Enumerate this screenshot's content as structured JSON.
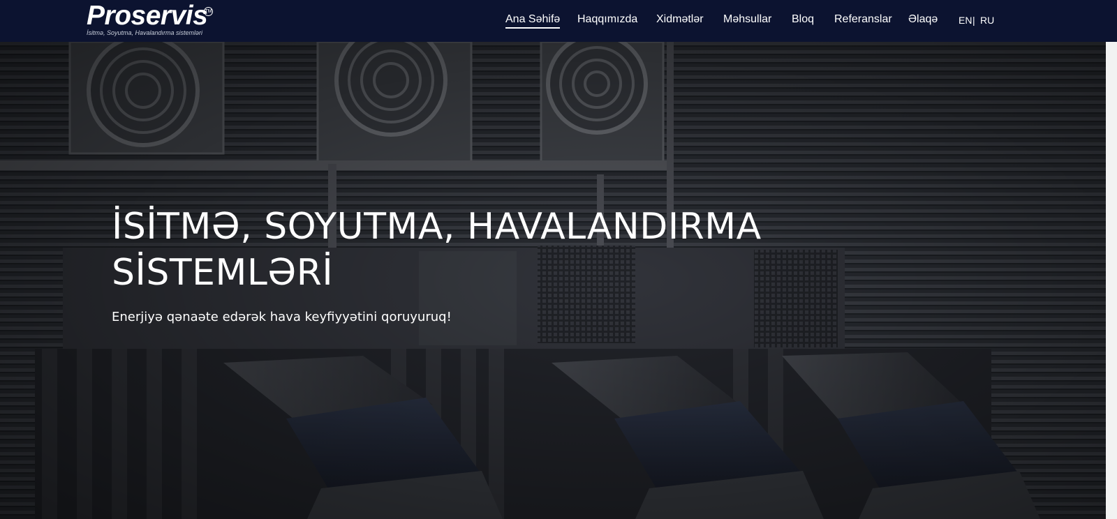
{
  "brand": {
    "name": "Proservis",
    "trademark": "TM",
    "tagline": "İsitmə, Soyutma, Havalandırma sistemləri"
  },
  "nav": {
    "items": [
      {
        "label": "Ana Səhifə",
        "active": true
      },
      {
        "label": "Haqqımızda",
        "active": false
      },
      {
        "label": "Xidmətlər",
        "active": false
      },
      {
        "label": "Məhsullar",
        "active": false
      },
      {
        "label": "Bloq",
        "active": false
      },
      {
        "label": "Referanslar",
        "active": false
      },
      {
        "label": "Əlaqə",
        "active": false
      }
    ],
    "languages": [
      "EN",
      "RU"
    ],
    "language_separator": "|"
  },
  "hero": {
    "title_line1": "İSİTMƏ, SOYUTMA, HAVALANDIRMA",
    "title_line2": "SİSTEMLƏRİ",
    "subtitle": "Enerjiyə qənaəte edərək hava keyfiyyətini qoruyuruq!",
    "image_subject": "hvac-units-photo"
  },
  "colors": {
    "navbar_bg": "#0c1330",
    "text": "#ffffff",
    "hero_overlay": "#15171c"
  }
}
